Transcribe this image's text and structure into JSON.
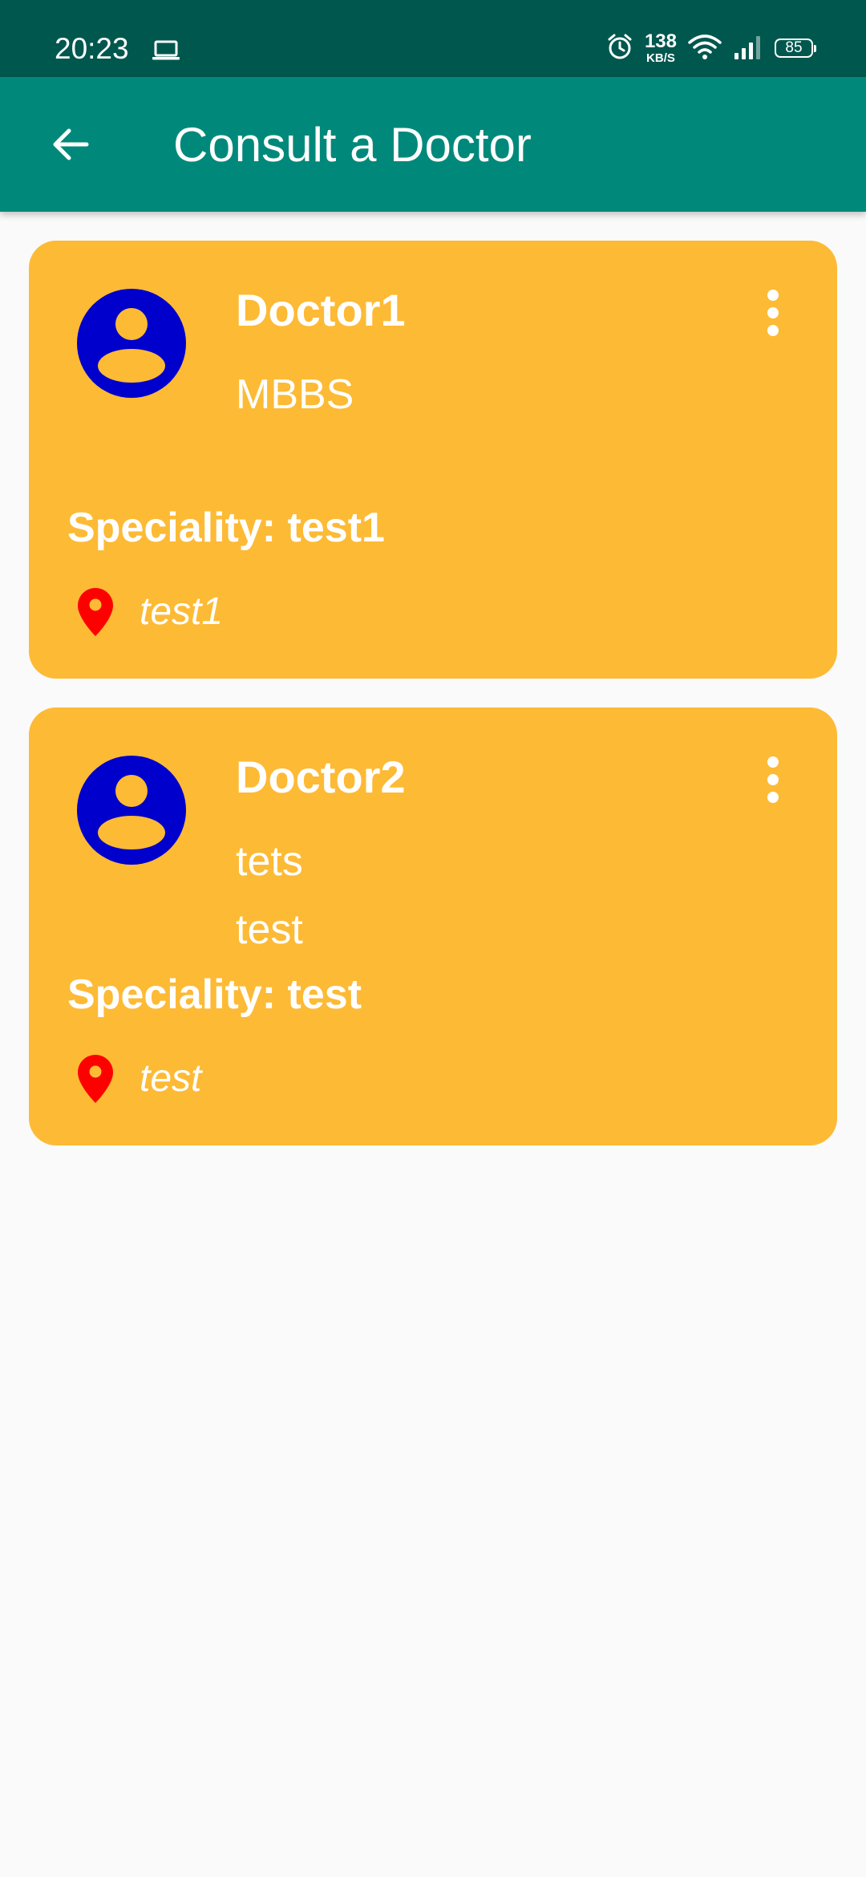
{
  "status_bar": {
    "time": "20:23",
    "net_speed": "138",
    "net_speed_unit": "KB/S",
    "battery": "85"
  },
  "app_bar": {
    "title": "Consult a Doctor",
    "back_icon": "arrow-back-icon"
  },
  "colors": {
    "status_bar": "#00574e",
    "app_bar": "#00897b",
    "card": "#fdba35",
    "avatar": "#0000cc",
    "location_pin": "#ff0000",
    "background": "#fafafa"
  },
  "doctors": [
    {
      "name": "Doctor1",
      "lines": [
        "MBBS"
      ],
      "speciality": "Speciality: test1",
      "location": "test1"
    },
    {
      "name": "Doctor2",
      "lines": [
        "tets",
        "test"
      ],
      "speciality": "Speciality: test",
      "location": "test"
    }
  ]
}
